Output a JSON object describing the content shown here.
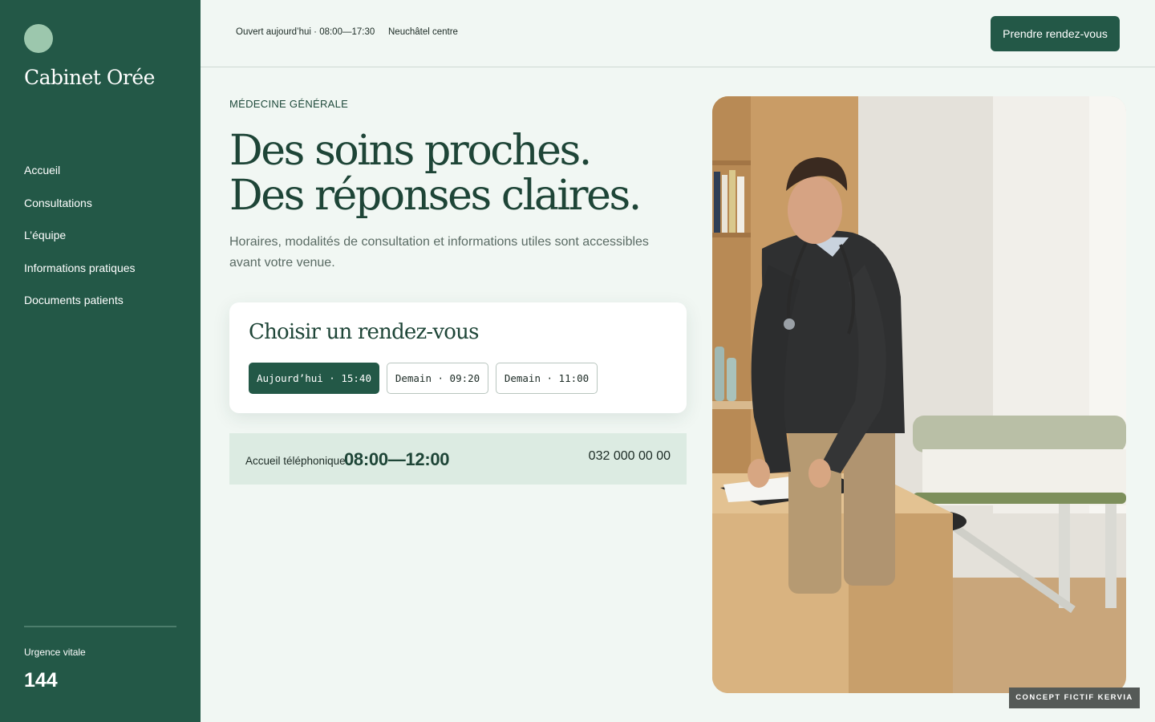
{
  "sidebar": {
    "brand": "Cabinet Orée",
    "nav": [
      {
        "label": "Accueil"
      },
      {
        "label": "Consultations"
      },
      {
        "label": "L’équipe"
      },
      {
        "label": "Informations pratiques"
      },
      {
        "label": "Documents patients"
      }
    ],
    "emergency_label": "Urgence vitale",
    "emergency_number": "144"
  },
  "topbar": {
    "hours": "Ouvert aujourd’hui · 08:00—17:30",
    "location": "Neuchâtel centre",
    "cta_label": "Prendre rendez-vous"
  },
  "hero": {
    "eyebrow": "MÉDECINE GÉNÉRALE",
    "headline_line1": "Des soins proches.",
    "headline_line2": "Des réponses claires.",
    "intro": "Horaires, modalités de consultation et informations utiles sont accessibles avant votre venue."
  },
  "booking": {
    "title": "Choisir un rendez-vous",
    "slots": [
      {
        "label": "Aujourd’hui · 15:40",
        "selected": true
      },
      {
        "label": "Demain · 09:20",
        "selected": false
      },
      {
        "label": "Demain · 11:00",
        "selected": false
      }
    ]
  },
  "phone": {
    "label": "Accueil téléphonique",
    "hours": "08:00—12:00",
    "number": "032 000 00 00"
  },
  "badge": "CONCEPT FICTIF KERVIA",
  "colors": {
    "brand_green": "#235847",
    "accent_mint": "#9cc7ad",
    "background": "#f1f7f3",
    "phone_panel": "#dcebe2"
  }
}
